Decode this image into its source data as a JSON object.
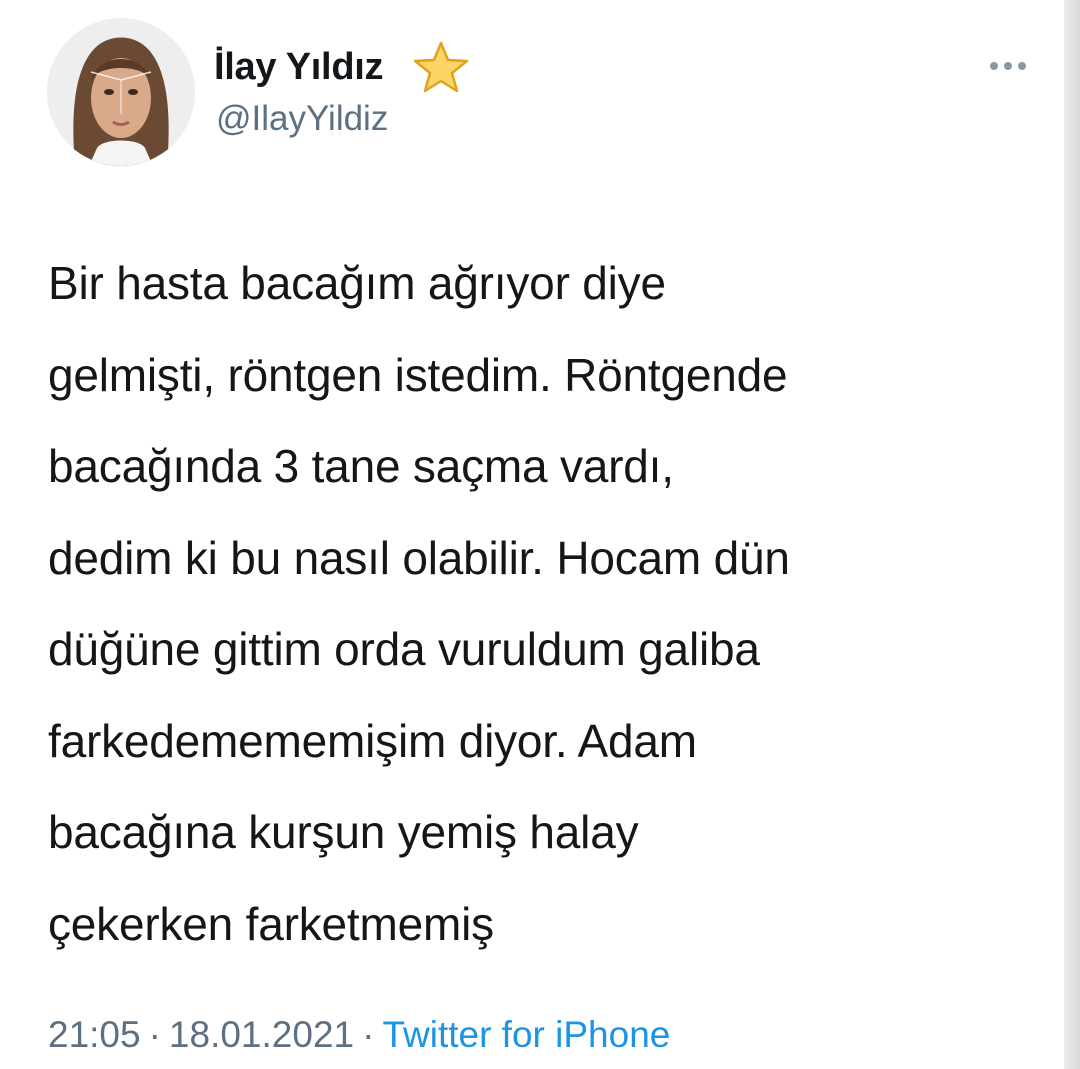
{
  "tweet": {
    "author": {
      "display_name": "İlay Yıldız",
      "handle": "@IlayYildiz",
      "badge_icon": "star-icon"
    },
    "menu_icon": "more-icon",
    "text_lines": [
      "Bir hasta bacağım ağrıyor diye",
      "gelmişti, röntgen istedim. Röntgende",
      "bacağında 3 tane saçma vardı,",
      "dedim ki bu nasıl olabilir. Hocam dün",
      "düğüne gittim orda vuruldum galiba",
      "farkedemememişim diyor. Adam",
      "bacağına kurşun yemiş halay",
      "çekerken farketmemiş"
    ],
    "time": "21:05",
    "separator": "·",
    "date": "18.01.2021",
    "source": "Twitter for iPhone"
  },
  "colors": {
    "text": "#14171a",
    "secondary": "#5b7083",
    "link": "#1b95e0",
    "star": "#f7c948"
  }
}
